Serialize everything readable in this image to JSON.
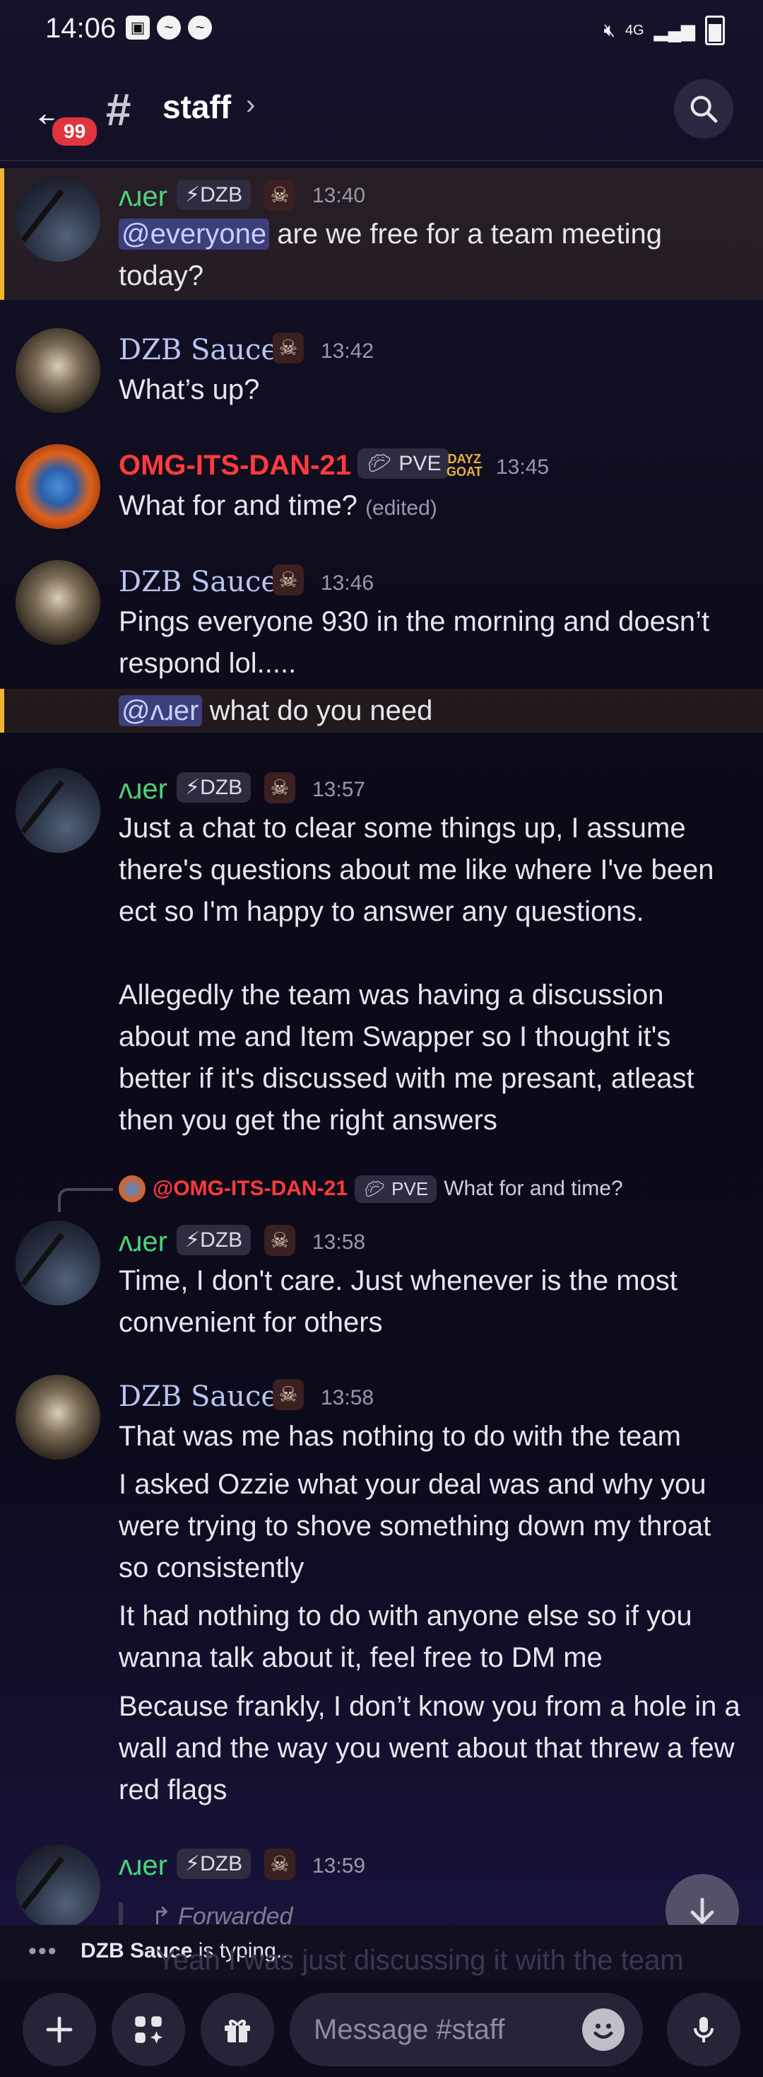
{
  "status_bar": {
    "time": "14:06",
    "network": "4G"
  },
  "header": {
    "unread_badge": "99",
    "channel_name": "staff",
    "hash_symbol": "#",
    "back_glyph": "←",
    "chevron_glyph": "›"
  },
  "messages": [
    {
      "author": "ʌɹer",
      "tag": "DZB",
      "time": "13:40",
      "mention": "@everyone",
      "text": " are we free for a team meeting today?"
    },
    {
      "author": "DZB Sauce",
      "time": "13:42",
      "text": "What’s up?"
    },
    {
      "author": "OMG-ITS-DAN-21",
      "tag": "PVE",
      "badge_line1": "DAYZ",
      "badge_line2": "GOAT",
      "time": "13:45",
      "text": "What for and time?",
      "edited": "(edited)"
    },
    {
      "author": "DZB Sauce",
      "time": "13:46",
      "text": "Pings everyone 930 in the morning and doesn’t respond lol.....",
      "followup_mention": "@ʌɹer",
      "followup_text": " what do you need"
    },
    {
      "author": "ʌɹer",
      "tag": "DZB",
      "time": "13:57",
      "text": "Just a chat to clear some things up, I assume there's questions about me like where I've been ect so I'm happy to answer any questions.\n\nAllegedly the team was having a discussion about me and Item Swapper so I thought it's better if it's discussed with me presant, atleast then you get the right answers"
    },
    {
      "reply_to_author": "@OMG-ITS-DAN-21",
      "reply_to_tag": "PVE",
      "reply_to_text": "What for and time?",
      "author": "ʌɹer",
      "tag": "DZB",
      "time": "13:58",
      "text": "Time, I don't care. Just whenever is the most convenient for others"
    },
    {
      "author": "DZB Sauce",
      "time": "13:58",
      "text1": "That was me has nothing to do with the team",
      "text2": "I asked Ozzie what your deal was and why you were trying to shove something down my throat so consistently",
      "text3": "It had nothing to do with anyone else so if you wanna talk about it, feel free to DM me",
      "text4": "Because frankly, I don’t know you from a hole in a wall and the way you went about that threw a few red flags"
    },
    {
      "author": "ʌɹer",
      "tag": "DZB",
      "time": "13:59",
      "forwarded": "Forwarded",
      "faded_text": "Yeah I was just discussing it with the team"
    }
  ],
  "typing": {
    "user": "DZB Sauce",
    "suffix": " is typing..."
  },
  "composer": {
    "placeholder": "Message #staff"
  },
  "icons": [
    "back-arrow-icon",
    "hash-icon",
    "search-icon",
    "arrow-down-icon",
    "plus-icon",
    "apps-icon",
    "gift-icon",
    "emoji-icon",
    "mic-icon"
  ]
}
